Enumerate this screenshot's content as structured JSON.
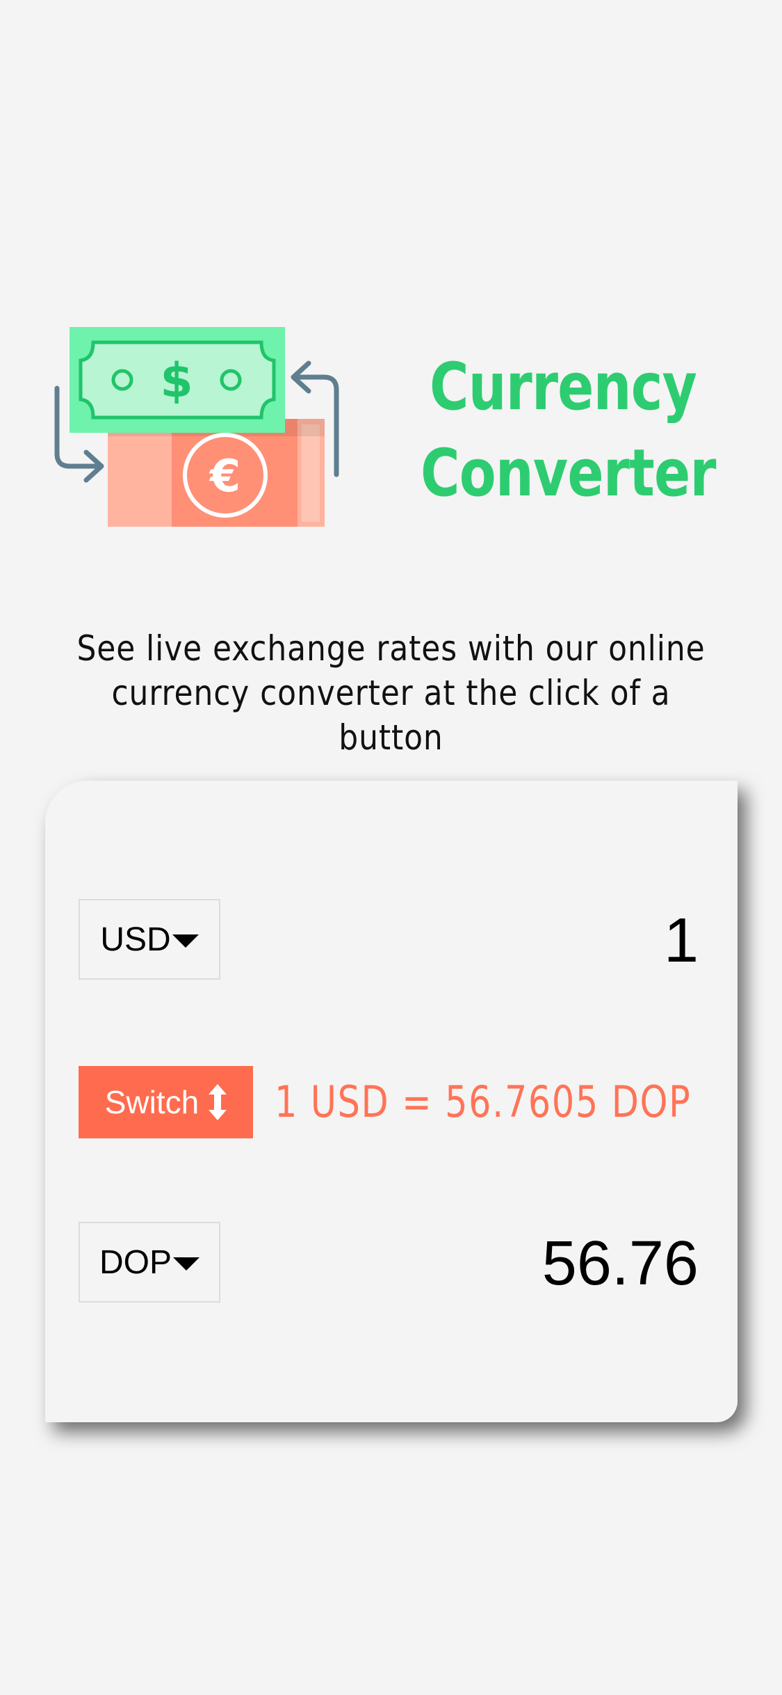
{
  "header": {
    "logo_icon": "currency-exchange-icon",
    "title_line1": "Currency",
    "title_line2": "Converter",
    "accent_color": "#2ecc71"
  },
  "subtitle": {
    "line1": "See live exchange rates with our online",
    "line2": "currency converter at the click of a button"
  },
  "converter": {
    "from_currency": "USD",
    "from_amount": "1",
    "to_currency": "DOP",
    "to_amount": "56.76",
    "switch_label": "Switch",
    "rate_text": "1 USD = 56.7605 DOP",
    "switch_color": "#ff6b4e",
    "rate_color": "#ff7356"
  }
}
